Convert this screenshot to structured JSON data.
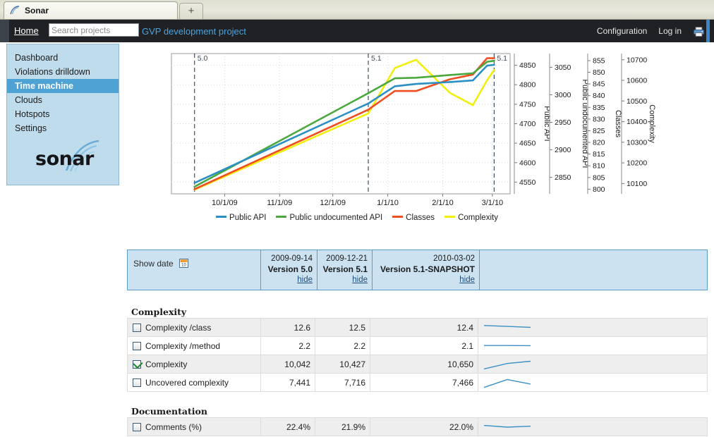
{
  "browser": {
    "tab_title": "Sonar",
    "new_tab_label": "+"
  },
  "nav": {
    "home_label": "Home",
    "search_placeholder": "Search projects",
    "search_value": "",
    "project_link": "GVP development project",
    "configuration_label": "Configuration",
    "login_label": "Log in",
    "print_icon": "printer-icon"
  },
  "sidebar": {
    "items": [
      {
        "label": "Dashboard",
        "active": false
      },
      {
        "label": "Violations drilldown",
        "active": false
      },
      {
        "label": "Time machine",
        "active": true
      },
      {
        "label": "Clouds",
        "active": false
      },
      {
        "label": "Hotspots",
        "active": false
      },
      {
        "label": "Settings",
        "active": false
      }
    ],
    "logo_text": "sonar"
  },
  "chart_data": {
    "type": "line",
    "title": "",
    "xlabel": "",
    "ylabel": "",
    "grid": true,
    "legend_position": "bottom",
    "x_tick_labels": [
      "10/1/09",
      "11/1/09",
      "12/1/09",
      "1/1/10",
      "2/1/10",
      "3/1/10"
    ],
    "version_markers": [
      {
        "label": "5.0",
        "x": "2009-09-14"
      },
      {
        "label": "5.1",
        "x": "2009-12-21"
      },
      {
        "label": "5.1",
        "x": "2010-03-02"
      }
    ],
    "axes": [
      {
        "name": "Public API",
        "color": "#2b8fc4",
        "ticks": [
          4550,
          4600,
          4650,
          4700,
          4750,
          4800,
          4850
        ],
        "range": [
          4520,
          4880
        ]
      },
      {
        "name": "Public undocumented API",
        "color": "#4aa83d",
        "ticks": [
          2850,
          2900,
          2950,
          3000,
          3050
        ],
        "range": [
          2820,
          3075
        ]
      },
      {
        "name": "Classes",
        "color": "#ef4e23",
        "ticks": [
          800,
          805,
          810,
          815,
          820,
          825,
          830,
          835,
          840,
          845,
          850,
          855
        ],
        "range": [
          798,
          858
        ]
      },
      {
        "name": "Complexity",
        "color": "#f2ee0d",
        "ticks": [
          10100,
          10200,
          10300,
          10400,
          10500,
          10600,
          10700
        ],
        "range": [
          10050,
          10730
        ]
      }
    ],
    "series": [
      {
        "name": "Public API",
        "color": "#2b8fc4",
        "axis": "Public API",
        "x": [
          "2009-09-14",
          "2009-12-21",
          "2010-01-05",
          "2010-01-17",
          "2010-02-05",
          "2010-02-18",
          "2010-02-26",
          "2010-03-02"
        ],
        "values": [
          4548,
          4752,
          4796,
          4802,
          4807,
          4811,
          4849,
          4851
        ]
      },
      {
        "name": "Public undocumented API",
        "color": "#4aa83d",
        "axis": "Public undocumented API",
        "x": [
          "2009-09-14",
          "2009-12-21",
          "2010-01-05",
          "2010-01-17",
          "2010-02-05",
          "2010-02-18",
          "2010-02-26",
          "2010-03-02"
        ],
        "values": [
          2833,
          3003,
          3030,
          3031,
          3036,
          3039,
          3060,
          3062
        ]
      },
      {
        "name": "Classes",
        "color": "#ef4e23",
        "axis": "Classes",
        "x": [
          "2009-09-14",
          "2009-12-21",
          "2010-01-05",
          "2010-01-17",
          "2010-02-05",
          "2010-02-18",
          "2010-02-26",
          "2010-03-02"
        ],
        "values": [
          800,
          834,
          842,
          842,
          847,
          849,
          856,
          856
        ]
      },
      {
        "name": "Complexity",
        "color": "#f2ee0d",
        "axis": "Complexity",
        "x": [
          "2009-09-14",
          "2009-12-21",
          "2010-01-05",
          "2010-01-17",
          "2010-02-05",
          "2010-02-18",
          "2010-02-26",
          "2010-03-02"
        ],
        "values": [
          10070,
          10440,
          10660,
          10700,
          10540,
          10480,
          10600,
          10650
        ]
      }
    ],
    "legend": [
      {
        "label": "Public API",
        "color": "#2b8fc4"
      },
      {
        "label": "Public undocumented API",
        "color": "#4aa83d"
      },
      {
        "label": "Classes",
        "color": "#ef4e23"
      },
      {
        "label": "Complexity",
        "color": "#f2ee0d"
      }
    ]
  },
  "date_header": {
    "show_date_label": "Show date",
    "calendar_icon": "calendar-icon",
    "columns": [
      {
        "date": "2009-09-14",
        "version": "Version 5.0",
        "hide_label": "hide"
      },
      {
        "date": "2009-12-21",
        "version": "Version 5.1",
        "hide_label": "hide"
      },
      {
        "date": "2010-03-02",
        "version": "Version 5.1-SNAPSHOT",
        "hide_label": "hide"
      }
    ]
  },
  "sections": [
    {
      "title": "Complexity",
      "rows": [
        {
          "label": "Complexity /class",
          "checked": false,
          "values": [
            "12.6",
            "12.5",
            "12.4"
          ],
          "spark": [
            0.3,
            0.38,
            0.46
          ]
        },
        {
          "label": "Complexity /method",
          "checked": false,
          "values": [
            "2.2",
            "2.2",
            "2.1"
          ],
          "spark": [
            0.45,
            0.45,
            0.46
          ]
        },
        {
          "label": "Complexity",
          "checked": true,
          "values": [
            "10,042",
            "10,427",
            "10,650"
          ],
          "spark": [
            0.9,
            0.42,
            0.22
          ]
        },
        {
          "label": "Uncovered complexity",
          "checked": false,
          "values": [
            "7,441",
            "7,716",
            "7,466"
          ],
          "spark": [
            0.92,
            0.22,
            0.62
          ]
        }
      ]
    },
    {
      "title": "Documentation",
      "rows": [
        {
          "label": "Comments (%)",
          "checked": false,
          "values": [
            "22.4%",
            "21.9%",
            "22.0%"
          ],
          "spark": [
            0.35,
            0.5,
            0.42
          ]
        }
      ]
    }
  ]
}
